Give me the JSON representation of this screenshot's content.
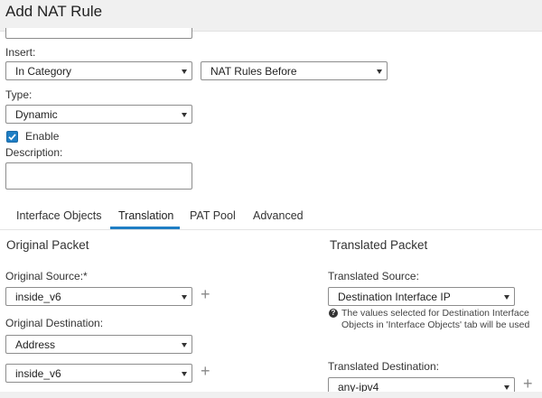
{
  "window": {
    "title": "Add NAT Rule"
  },
  "form": {
    "insert": {
      "label": "Insert:",
      "position": "In Category",
      "rules": "NAT Rules Before"
    },
    "type": {
      "label": "Type:",
      "value": "Dynamic"
    },
    "enable": {
      "label": "Enable",
      "checked": true
    },
    "description": {
      "label": "Description:",
      "value": ""
    }
  },
  "tabs": [
    {
      "label": "Interface Objects",
      "active": false
    },
    {
      "label": "Translation",
      "active": true
    },
    {
      "label": "PAT Pool",
      "active": false
    },
    {
      "label": "Advanced",
      "active": false
    }
  ],
  "original": {
    "heading": "Original Packet",
    "source_label": "Original Source:*",
    "source_value": "inside_v6",
    "destination_label": "Original Destination:",
    "destination_type": "Address",
    "destination_value": "inside_v6"
  },
  "translated": {
    "heading": "Translated Packet",
    "source_label": "Translated Source:",
    "source_value": "Destination Interface IP",
    "info_text": "The values selected for Destination Interface Objects in 'Interface Objects' tab will be used",
    "destination_label": "Translated Destination:",
    "destination_value": "any-ipv4"
  },
  "icons": {
    "add": "plus-icon",
    "info": "info-icon",
    "dropdown": "chevron-down-icon",
    "check": "checkmark-icon"
  },
  "colors": {
    "accent": "#1f7ec4"
  }
}
